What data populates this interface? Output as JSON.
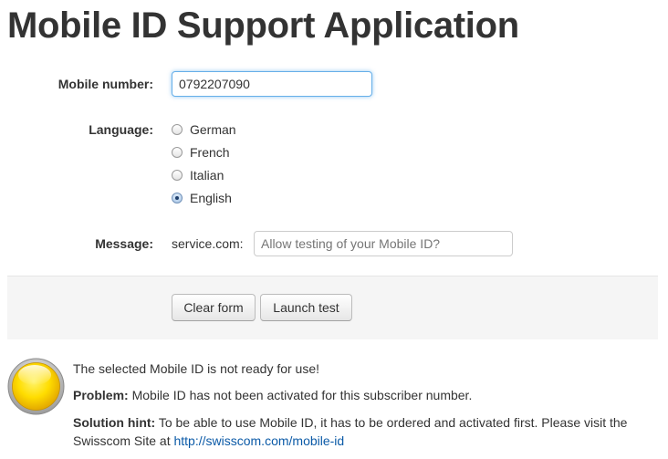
{
  "page": {
    "title": "Mobile ID Support Application"
  },
  "form": {
    "mobile_label": "Mobile number:",
    "mobile_value": "0792207090",
    "language_label": "Language:",
    "languages": [
      {
        "label": "German",
        "checked": false
      },
      {
        "label": "French",
        "checked": false
      },
      {
        "label": "Italian",
        "checked": false
      },
      {
        "label": "English",
        "checked": true
      }
    ],
    "message_label": "Message:",
    "message_prefix": "service.com:",
    "message_placeholder": "Allow testing of your Mobile ID?"
  },
  "actions": {
    "clear_label": "Clear form",
    "launch_label": "Launch test"
  },
  "result": {
    "status_color": "#ffd800",
    "status_icon": "yellow-status-light-icon",
    "summary": "The selected Mobile ID is not ready for use!",
    "problem_label": "Problem:",
    "problem_text": "Mobile ID has not been activated for this subscriber number.",
    "solution_label": "Solution hint:",
    "solution_text": "To be able to use Mobile ID, it has to be ordered and activated first. Please visit the Swisscom Site at",
    "solution_link": "http://swisscom.com/mobile-id"
  }
}
